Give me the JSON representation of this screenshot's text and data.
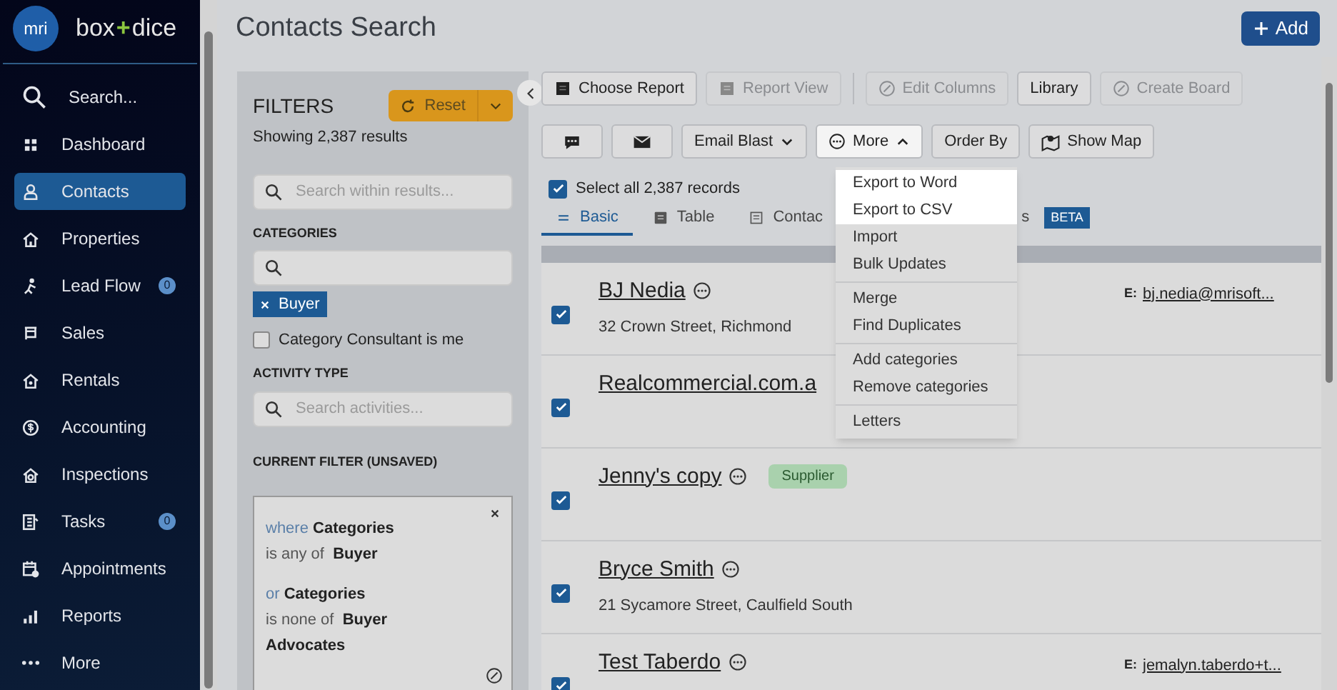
{
  "sidebar": {
    "logo": {
      "mark": "mri",
      "brand_left": "box",
      "brand_plus": "+",
      "brand_right": "dice"
    },
    "items": [
      {
        "label": "Search...",
        "selected": false
      },
      {
        "label": "Dashboard",
        "selected": false
      },
      {
        "label": "Contacts",
        "selected": true
      },
      {
        "label": "Properties",
        "selected": false
      },
      {
        "label": "Lead Flow",
        "selected": false,
        "badge": "0"
      },
      {
        "label": "Sales",
        "selected": false
      },
      {
        "label": "Rentals",
        "selected": false
      },
      {
        "label": "Accounting",
        "selected": false
      },
      {
        "label": "Inspections",
        "selected": false
      },
      {
        "label": "Tasks",
        "selected": false,
        "badge": "0"
      },
      {
        "label": "Appointments",
        "selected": false
      },
      {
        "label": "Reports",
        "selected": false
      },
      {
        "label": "More",
        "selected": false
      }
    ]
  },
  "header": {
    "title": "Contacts Search",
    "add_button": "Add"
  },
  "filters": {
    "title": "FILTERS",
    "reset_button": "Reset",
    "results": "Showing 2,387 results",
    "search": {
      "placeholder": "Search within results..."
    },
    "categories": {
      "heading": "CATEGORIES",
      "chips": [
        "Buyer"
      ],
      "consultant": {
        "label": "Category Consultant is me",
        "checked": false
      }
    },
    "activity": {
      "heading": "ACTIVITY TYPE",
      "placeholder": "Search activities..."
    },
    "current": {
      "heading": "CURRENT FILTER (UNSAVED)",
      "clauses": [
        {
          "lead": "where",
          "field": "Categories",
          "op": "is any of",
          "value": "Buyer"
        },
        {
          "lead": "or",
          "field": "Categories",
          "op": "is none of",
          "value": "Buyer Advocates"
        }
      ]
    }
  },
  "toolbar": {
    "row_1": [
      {
        "label": "Choose Report",
        "disabled": false
      },
      {
        "label": "Report View",
        "disabled": true
      },
      {
        "label": "Edit Columns",
        "disabled": true
      },
      {
        "label": "Library",
        "disabled": false
      },
      {
        "label": "Create Board",
        "disabled": true
      }
    ],
    "row_2": [
      {
        "kind": "chat"
      },
      {
        "kind": "mail"
      },
      {
        "kind": "dropdown",
        "label": "Email Blast",
        "expanded": false
      },
      {
        "kind": "more",
        "label": "More",
        "expanded": true
      },
      {
        "kind": "plain",
        "label": "Order By"
      },
      {
        "kind": "map",
        "label": "Show Map"
      }
    ]
  },
  "select_all": {
    "label": "Select all 2,387 records",
    "checked": true
  },
  "tabs": [
    {
      "label": "Basic",
      "selected": true
    },
    {
      "label": "Table",
      "selected": false
    },
    {
      "label": "Contac",
      "selected": false
    },
    {
      "label": "s",
      "selected": false,
      "badge": "BETA"
    }
  ],
  "more_menu": [
    [
      {
        "label": "Export to Word",
        "highlighted": true
      },
      {
        "label": "Export to CSV",
        "highlighted": true
      },
      {
        "label": "Import",
        "highlighted": false
      },
      {
        "label": "Bulk Updates",
        "highlighted": false
      }
    ],
    [
      {
        "label": "Merge",
        "highlighted": false
      },
      {
        "label": "Find Duplicates",
        "highlighted": false
      }
    ],
    [
      {
        "label": "Add categories",
        "highlighted": false
      },
      {
        "label": "Remove categories",
        "highlighted": false
      }
    ],
    [
      {
        "label": "Letters",
        "highlighted": false
      }
    ]
  ],
  "contacts": [
    {
      "name": "BJ Nedia",
      "address": "32 Crown Street, Richmond",
      "email_label": "E:",
      "email": "bj.nedia@mrisoft...",
      "checked": true
    },
    {
      "name": "Realcommercial.com.a",
      "checked": true
    },
    {
      "name": "Jenny's copy",
      "tag": "Supplier",
      "checked": true
    },
    {
      "name": "Bryce Smith",
      "address": "21 Sycamore Street, Caulfield South",
      "checked": true
    },
    {
      "name": "Test Taberdo",
      "email_label": "E:",
      "email": "jemalyn.taberdo+t...",
      "checked": true
    }
  ]
}
